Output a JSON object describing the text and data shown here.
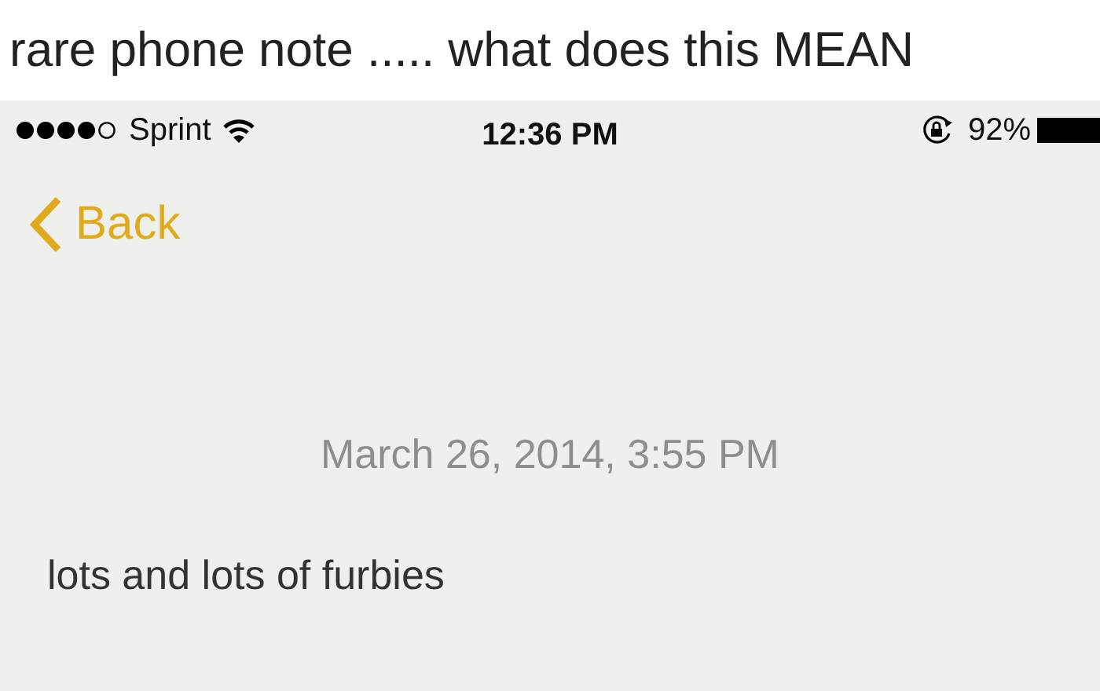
{
  "caption": "rare phone note ..... what does this MEAN",
  "status_bar": {
    "carrier": "Sprint",
    "time": "12:36 PM",
    "battery": "92%"
  },
  "nav": {
    "back": "Back"
  },
  "note": {
    "date": "March 26, 2014, 3:55 PM",
    "body": "lots and lots of furbies"
  }
}
